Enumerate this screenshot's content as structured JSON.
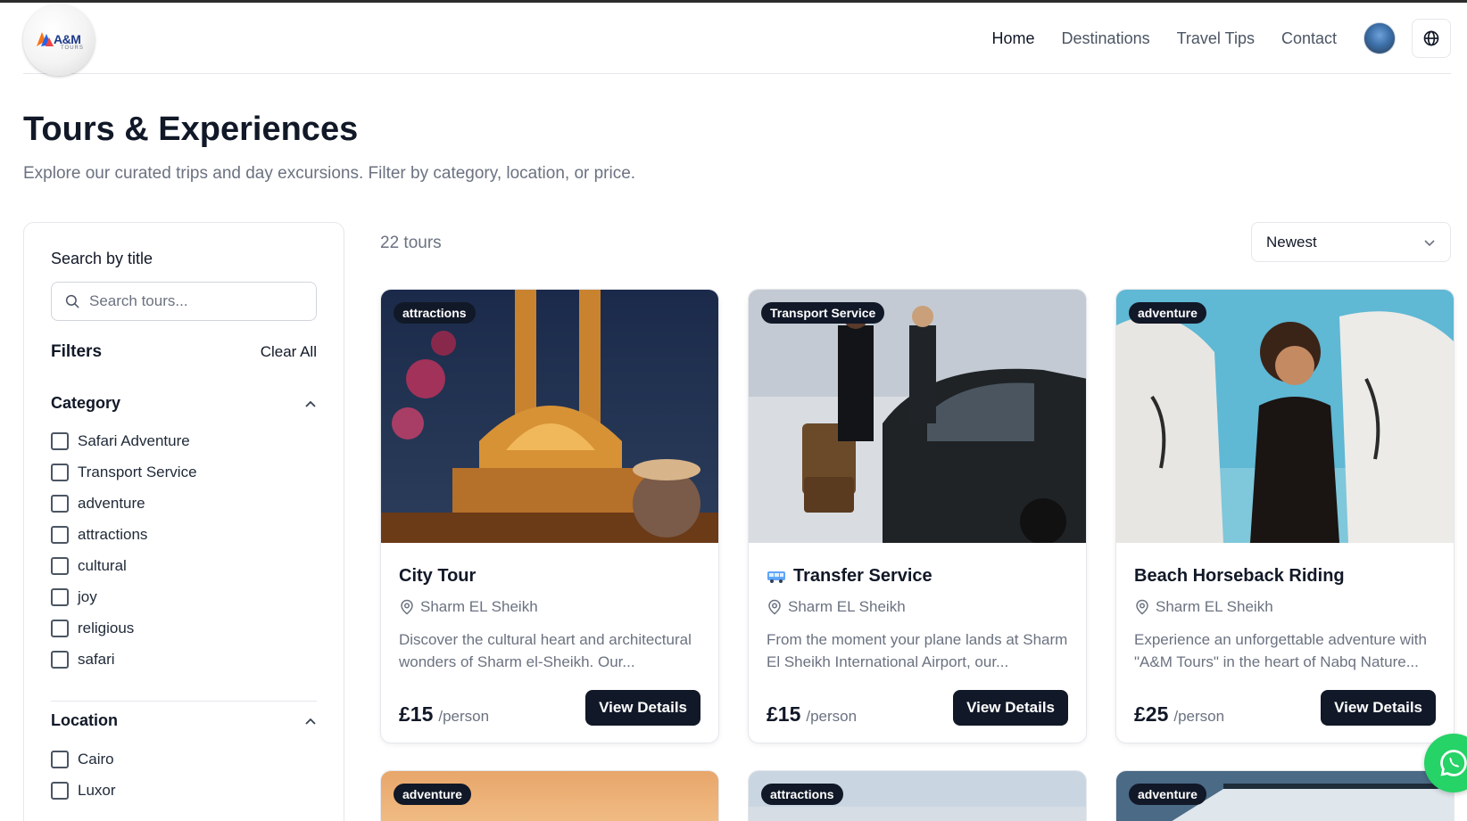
{
  "brand": {
    "logo_text": "A&M",
    "logo_sub": "TOURS"
  },
  "nav": {
    "items": [
      {
        "label": "Home",
        "active": true
      },
      {
        "label": "Destinations",
        "active": false
      },
      {
        "label": "Travel Tips",
        "active": false
      },
      {
        "label": "Contact",
        "active": false
      }
    ],
    "language_icon": "globe-icon",
    "avatar_icon": "user-avatar"
  },
  "page": {
    "title": "Tours & Experiences",
    "subtitle": "Explore our curated trips and day excursions. Filter by category, location, or price."
  },
  "sidebar": {
    "search_label": "Search by title",
    "search_placeholder": "Search tours...",
    "filters_title": "Filters",
    "clear_all": "Clear All",
    "category_title": "Category",
    "categories": [
      "Safari Adventure",
      "Transport Service",
      "adventure",
      "attractions",
      "cultural",
      "joy",
      "religious",
      "safari"
    ],
    "location_title": "Location",
    "locations": [
      "Cairo",
      "Luxor"
    ]
  },
  "results": {
    "count": "22 tours",
    "sort_value": "Newest",
    "cards": [
      {
        "badge": "attractions",
        "title": "City Tour",
        "location": "Sharm EL Sheikh",
        "description": "Discover the cultural heart and architectural wonders of Sharm el-Sheikh. Our...",
        "price": "£15",
        "unit": "/person",
        "cta": "View Details"
      },
      {
        "badge": "Transport Service",
        "title": "Transfer Service",
        "title_icon": "bus-icon",
        "location": "Sharm EL Sheikh",
        "description": "From the moment your plane lands at Sharm El Sheikh International Airport, our...",
        "price": "£15",
        "unit": "/person",
        "cta": "View Details"
      },
      {
        "badge": "adventure",
        "title": "Beach Horseback Riding",
        "location": "Sharm EL Sheikh",
        "description": "Experience an unforgettable adventure with \"A&M Tours\" in the heart of Nabq Nature...",
        "price": "£25",
        "unit": "/person",
        "cta": "View Details"
      }
    ],
    "next_row_badges": [
      "adventure",
      "attractions",
      "adventure"
    ]
  },
  "colors": {
    "primary": "#111827",
    "muted": "#6b7280",
    "border": "#e5e7eb",
    "whatsapp": "#25d366"
  }
}
